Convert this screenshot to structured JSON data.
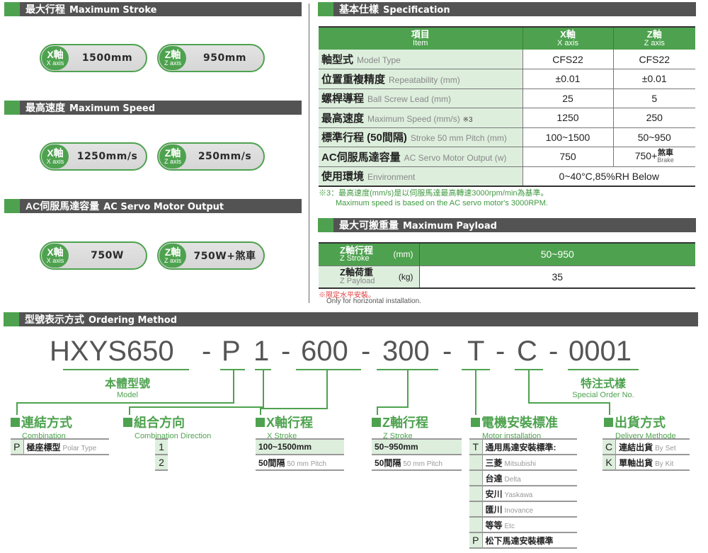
{
  "sections": {
    "max_stroke": {
      "zh": "最大行程",
      "en": "Maximum Stroke"
    },
    "max_speed": {
      "zh": "最高速度",
      "en": "Maximum Speed"
    },
    "servo_output": {
      "zh": "AC伺服馬達容量",
      "en": "AC Servo Motor Output"
    },
    "spec": {
      "zh": "基本仕樣",
      "en": "Specification"
    },
    "payload": {
      "zh": "最大可搬重量",
      "en": "Maximum Payload"
    },
    "ordering": {
      "zh": "型號表示方式",
      "en": "Ordering Method"
    }
  },
  "axis_badges": {
    "x": {
      "zh": "X軸",
      "en": "X axis"
    },
    "z": {
      "zh": "Z軸",
      "en": "Z axis"
    }
  },
  "pills": {
    "stroke": {
      "x": "1500mm",
      "z": "950mm"
    },
    "speed": {
      "x": "1250mm/s",
      "z": "250mm/s"
    },
    "output": {
      "x": "750W",
      "z": "750W+煞車"
    }
  },
  "spec_table": {
    "headers": [
      {
        "zh": "項目",
        "en": "Item"
      },
      {
        "zh": "X軸",
        "en": "X axis"
      },
      {
        "zh": "Z軸",
        "en": "Z axis"
      }
    ],
    "rows": [
      {
        "zh": "軸型式",
        "en": "Model Type",
        "mark": "",
        "x": "CFS22",
        "z": "CFS22"
      },
      {
        "zh": "位置重複精度",
        "en": "Repeatability (mm)",
        "mark": "",
        "x": "±0.01",
        "z": "±0.01"
      },
      {
        "zh": "螺桿導程",
        "en": "Ball Screw Lead (mm)",
        "mark": "",
        "x": "25",
        "z": "5"
      },
      {
        "zh": "最高速度",
        "en": "Maximum Speed (mm/s)",
        "mark": "※3",
        "x": "1250",
        "z": "250"
      },
      {
        "zh": "標準行程 (50間隔)",
        "en": "Stroke 50 mm Pitch (mm)",
        "mark": "",
        "x": "100~1500",
        "z": "50~950"
      },
      {
        "zh": "AC伺服馬達容量",
        "en": "AC Servo Motor Output (w)",
        "mark": "",
        "x": "750",
        "z": "750+",
        "z_brake_zh": "煞車",
        "z_brake_en": "Brake"
      },
      {
        "zh": "使用環境",
        "en": "Environment",
        "mark": "",
        "merged": "0~40°C,85%RH Below"
      }
    ],
    "note_zh": "※3：最高速度(mm/s)是以伺服馬達最高轉速3000rpm/min為基準。",
    "note_en": "Maximum speed is based on the AC servo motor's 3000RPM."
  },
  "payload_table": {
    "rows": [
      {
        "zh": "Z軸行程",
        "en": "Z Stroke",
        "unit": "(mm)",
        "value": "50~950"
      },
      {
        "zh": "Z軸荷重",
        "en": "Z Payload",
        "unit": "(kg)",
        "value": "35"
      }
    ],
    "note_zh": "※限定水平安裝。",
    "note_en": "Only for horizontal installation."
  },
  "ordering": {
    "code_parts": [
      "HXYS650",
      "-",
      "P",
      "1",
      "-",
      "600",
      "-",
      "300",
      "-",
      "T",
      "-",
      "C",
      "-",
      "0001"
    ],
    "model_label": {
      "zh": "本體型號",
      "en": "Model"
    },
    "special_label": {
      "zh": "特注式樣",
      "en": "Special Order No."
    },
    "categories": {
      "combination": {
        "zh": "連結方式",
        "en": "Combination",
        "options": [
          {
            "key": "P",
            "zh": "極座標型",
            "en": "Polar Type"
          }
        ]
      },
      "direction": {
        "zh": "組合方向",
        "en": "Combination Direction",
        "options": [
          "1",
          "2"
        ]
      },
      "x_stroke": {
        "zh": "X軸行程",
        "en": "X Stroke",
        "range": "100~1500mm",
        "pitch_zh": "50間隔",
        "pitch_en": "50 mm Pitch"
      },
      "z_stroke": {
        "zh": "Z軸行程",
        "en": "Z Stroke",
        "range": "50~950mm",
        "pitch_zh": "50間隔",
        "pitch_en": "50 mm Pitch"
      },
      "motor": {
        "zh": "電機安裝標准",
        "en": "Motor installation",
        "options": [
          {
            "key": "T",
            "zh": "通用馬達安裝標準:",
            "en": ""
          },
          {
            "key": "",
            "zh": "三菱",
            "en": "Mitsubishi"
          },
          {
            "key": "",
            "zh": "台達",
            "en": "Delta"
          },
          {
            "key": "",
            "zh": "安川",
            "en": "Yaskawa"
          },
          {
            "key": "",
            "zh": "匯川",
            "en": "Inovance"
          },
          {
            "key": "",
            "zh": "等等",
            "en": "Etc"
          },
          {
            "key": "P",
            "zh": "松下馬達安裝標準",
            "en": ""
          }
        ]
      },
      "delivery": {
        "zh": "出貨方式",
        "en": "Delivery Methode",
        "options": [
          {
            "key": "C",
            "zh": "連結出貨",
            "en": "By Set"
          },
          {
            "key": "K",
            "zh": "單軸出貨",
            "en": "By Kit"
          }
        ]
      }
    }
  },
  "colors": {
    "accent_green": "#4ea24f",
    "bar_gray": "#535353",
    "light_green": "#ddeedd"
  }
}
